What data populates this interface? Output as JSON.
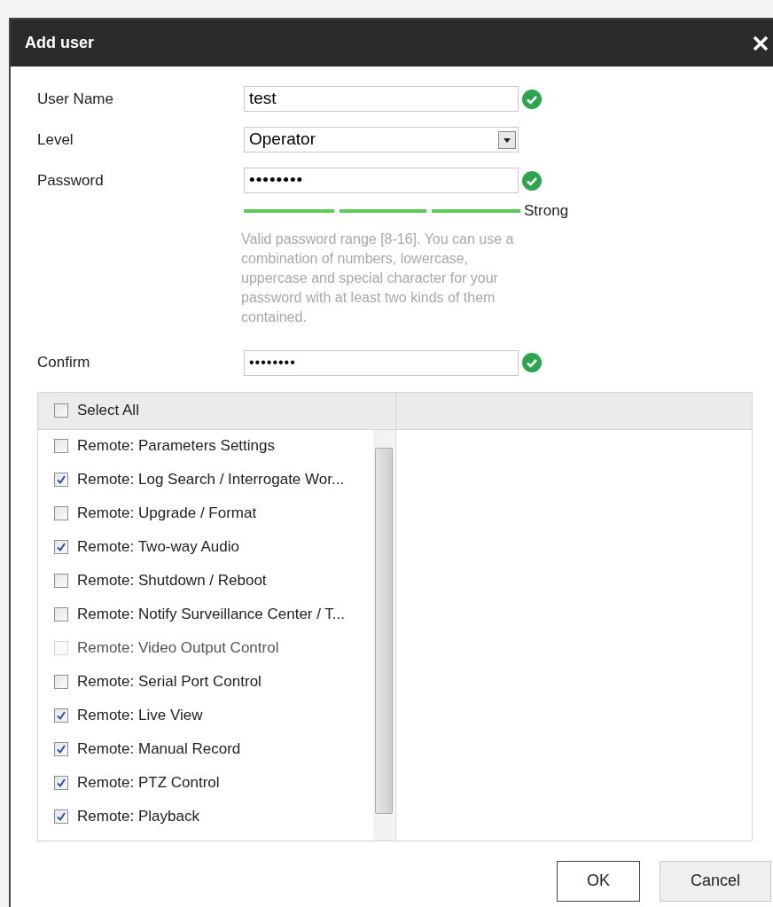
{
  "window": {
    "title": "Add user"
  },
  "fields": [
    {
      "kind": "text",
      "label": "User Name",
      "value": "test",
      "valid": true
    },
    {
      "kind": "select",
      "label": "Level",
      "value": "Operator"
    },
    {
      "kind": "password",
      "label": "Password",
      "value": "••••••••",
      "valid": true
    }
  ],
  "strength": {
    "level": 1,
    "label": "Strong"
  },
  "hint": "Valid password range [8-16]. You can use a combination of numbers, lowercase, uppercase and special character for your password with at least two kinds of them contained.",
  "confirm": {
    "label": "Confirm",
    "value": "••••••••",
    "valid": true
  },
  "select_all": {
    "label": "Select All",
    "checked": false
  },
  "permissions": [
    {
      "label": "Remote: Parameters Settings",
      "checked": false,
      "disabled": false
    },
    {
      "label": "Remote: Log Search / Interrogate Wor...",
      "checked": true,
      "disabled": false
    },
    {
      "label": "Remote: Upgrade / Format",
      "checked": false,
      "disabled": false
    },
    {
      "label": "Remote: Two-way Audio",
      "checked": true,
      "disabled": false
    },
    {
      "label": "Remote: Shutdown / Reboot",
      "checked": false,
      "disabled": false
    },
    {
      "label": "Remote: Notify Surveillance Center / T...",
      "checked": false,
      "disabled": false
    },
    {
      "label": "Remote: Video Output Control",
      "checked": false,
      "disabled": true
    },
    {
      "label": "Remote: Serial Port Control",
      "checked": false,
      "disabled": false
    },
    {
      "label": "Remote: Live View",
      "checked": true,
      "disabled": false
    },
    {
      "label": "Remote: Manual Record",
      "checked": true,
      "disabled": false
    },
    {
      "label": "Remote: PTZ Control",
      "checked": true,
      "disabled": false
    },
    {
      "label": "Remote: Playback",
      "checked": true,
      "disabled": false
    }
  ],
  "buttons": [
    {
      "label": "OK",
      "kind": "primary"
    },
    {
      "label": "Cancel",
      "kind": "secondary"
    }
  ]
}
